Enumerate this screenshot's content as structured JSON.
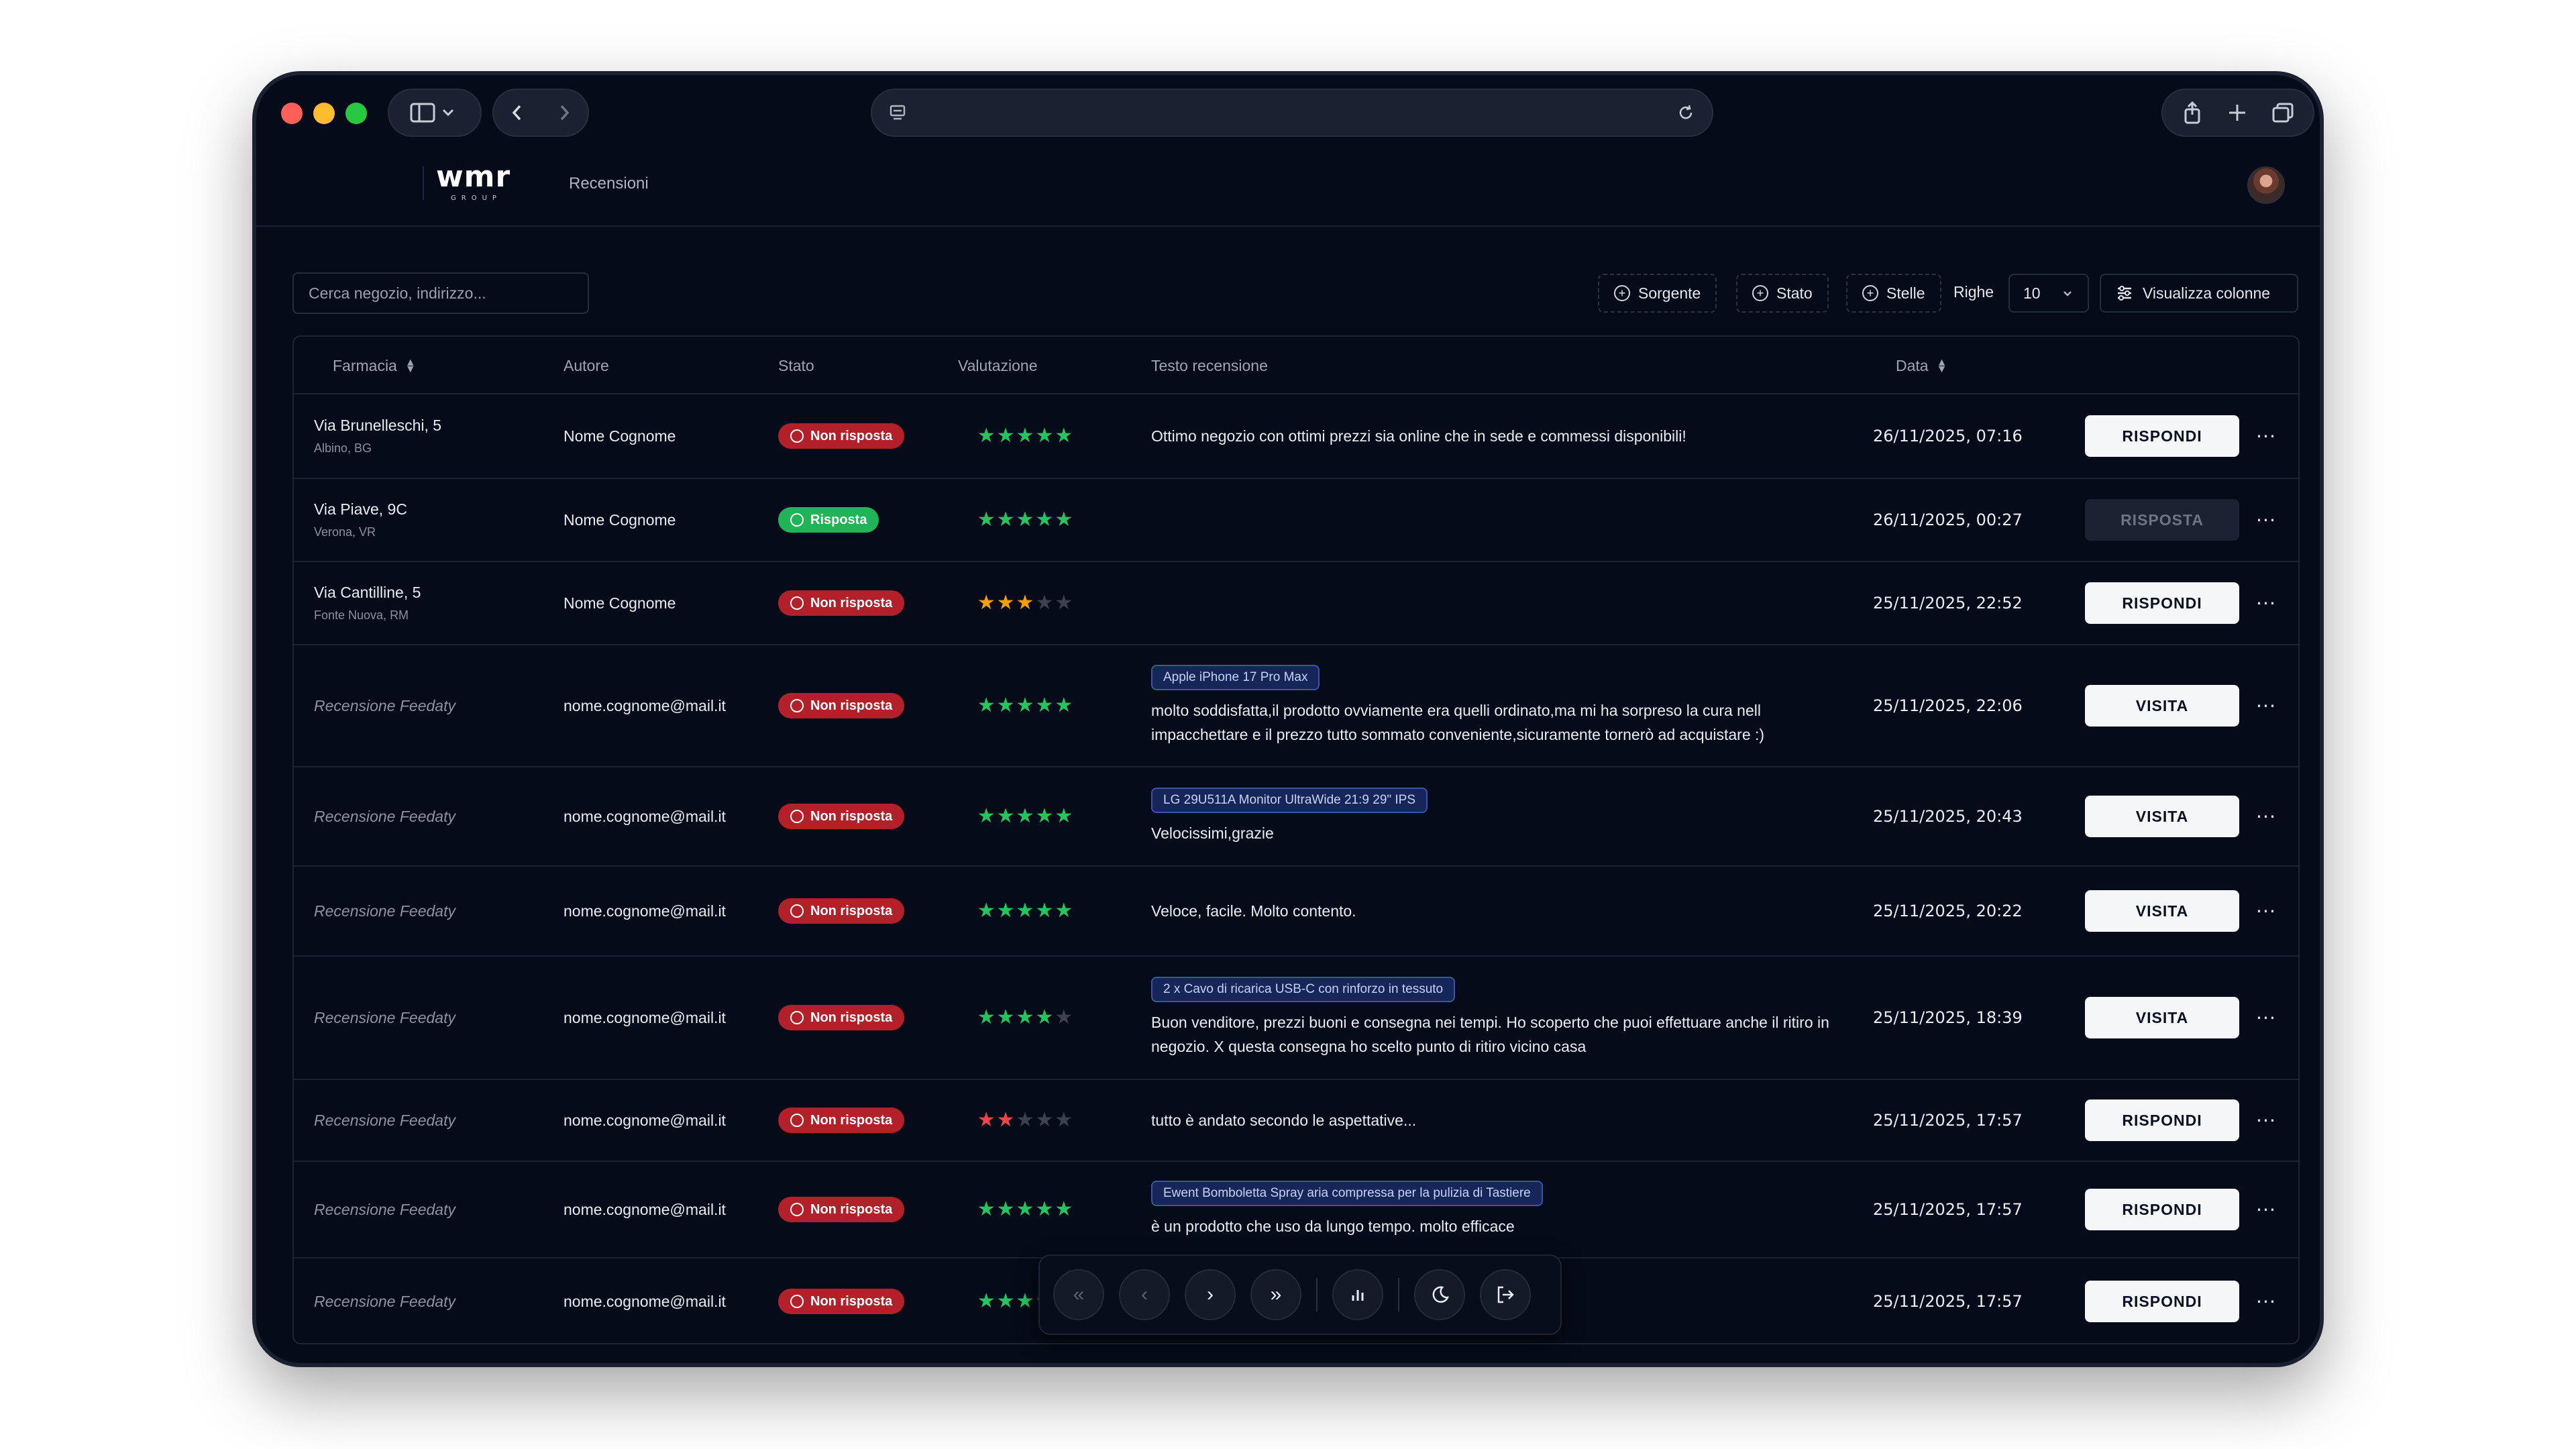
{
  "browser": {
    "address": "",
    "icons": [
      "sidebar-icon",
      "chevron-down-icon",
      "back-icon",
      "forward-icon",
      "site-settings-icon",
      "reload-icon",
      "share-icon",
      "new-tab-icon",
      "tabs-overview-icon"
    ]
  },
  "header": {
    "logo_text": "wmr",
    "logo_sub": "GROUP",
    "breadcrumb": "Recensioni"
  },
  "toolbar": {
    "search_placeholder": "Cerca negozio, indirizzo...",
    "filters": [
      "Sorgente",
      "Stato",
      "Stelle"
    ],
    "rows_label": "Righe",
    "rows_value": "10",
    "columns_button": "Visualizza colonne"
  },
  "table": {
    "headers": {
      "farmacia": "Farmacia",
      "autore": "Autore",
      "stato": "Stato",
      "valutazione": "Valutazione",
      "testo": "Testo recensione",
      "data": "Data"
    },
    "rows": [
      {
        "farmacia": "Via Brunelleschi, 5",
        "localita": "Albino, BG",
        "autore": "Nome Cognome",
        "stato": "Non risposta",
        "stelle": 5,
        "prodotto": "",
        "testo": "Ottimo negozio con ottimi prezzi sia online che in sede e commessi disponibili!",
        "data": "26/11/2025, 07:16",
        "azione": "RISPONDI"
      },
      {
        "farmacia": "Via Piave, 9C",
        "localita": "Verona, VR",
        "autore": "Nome Cognome",
        "stato": "Risposta",
        "stelle": 5,
        "prodotto": "",
        "testo": "",
        "data": "26/11/2025, 00:27",
        "azione": "RISPOSTA"
      },
      {
        "farmacia": "Via Cantilline, 5",
        "localita": "Fonte Nuova, RM",
        "autore": "Nome Cognome",
        "stato": "Non risposta",
        "stelle": 3,
        "prodotto": "",
        "testo": "",
        "data": "25/11/2025, 22:52",
        "azione": "RISPONDI"
      },
      {
        "farmacia": "Recensione Feedaty",
        "localita": "",
        "autore": "nome.cognome@mail.it",
        "stato": "Non risposta",
        "stelle": 5,
        "prodotto": "Apple iPhone 17 Pro Max",
        "testo": "molto soddisfatta,il prodotto ovviamente era quelli ordinato,ma mi ha sorpreso la cura nell impacchettare e  il prezzo tutto sommato conveniente,sicuramente tornerò ad acquistare  :)",
        "data": "25/11/2025, 22:06",
        "azione": "VISITA"
      },
      {
        "farmacia": "Recensione Feedaty",
        "localita": "",
        "autore": "nome.cognome@mail.it",
        "stato": "Non risposta",
        "stelle": 5,
        "prodotto": "LG 29U511A Monitor UltraWide 21:9 29\" IPS",
        "testo": "Velocissimi,grazie",
        "data": "25/11/2025, 20:43",
        "azione": "VISITA"
      },
      {
        "farmacia": "Recensione Feedaty",
        "localita": "",
        "autore": "nome.cognome@mail.it",
        "stato": "Non risposta",
        "stelle": 5,
        "prodotto": "",
        "testo": "Veloce,  facile.  Molto contento.",
        "data": "25/11/2025, 20:22",
        "azione": "VISITA"
      },
      {
        "farmacia": "Recensione Feedaty",
        "localita": "",
        "autore": "nome.cognome@mail.it",
        "stato": "Non risposta",
        "stelle": 4,
        "prodotto": "2 x Cavo di ricarica USB-C con rinforzo in tessuto",
        "testo": "Buon venditore, prezzi buoni e consegna nei tempi. Ho scoperto che puoi effettuare anche il ritiro in negozio. X questa consegna ho scelto punto di ritiro vicino casa",
        "data": "25/11/2025, 18:39",
        "azione": "VISITA"
      },
      {
        "farmacia": "Recensione Feedaty",
        "localita": "",
        "autore": "nome.cognome@mail.it",
        "stato": "Non risposta",
        "stelle": 2,
        "prodotto": "",
        "testo": "tutto è andato secondo le aspettative...",
        "data": "25/11/2025, 17:57",
        "azione": "RISPONDI"
      },
      {
        "farmacia": "Recensione Feedaty",
        "localita": "",
        "autore": "nome.cognome@mail.it",
        "stato": "Non risposta",
        "stelle": 5,
        "prodotto": "Ewent Bomboletta Spray aria compressa per la pulizia di Tastiere",
        "testo": "è un prodotto che uso da lungo tempo. molto efficace",
        "data": "25/11/2025, 17:57",
        "azione": "RISPONDI"
      },
      {
        "farmacia": "Recensione Feedaty",
        "localita": "",
        "autore": "nome.cognome@mail.it",
        "stato": "Non risposta",
        "stelle": 5,
        "prodotto": "",
        "testo": "",
        "data": "25/11/2025, 17:57",
        "azione": "RISPONDI"
      }
    ]
  },
  "pager": {
    "icons": [
      "first-page-icon",
      "previous-page-icon",
      "next-page-icon",
      "last-page-icon",
      "stats-icon",
      "dark-mode-icon",
      "logout-icon"
    ]
  },
  "colors": {
    "background": "#050b19",
    "status_red": "#b3202a",
    "status_green": "#1fb455",
    "star_green": "#22c55e",
    "star_orange": "#f59e0b",
    "star_red": "#ef4444",
    "chip_blue": "#162658"
  }
}
